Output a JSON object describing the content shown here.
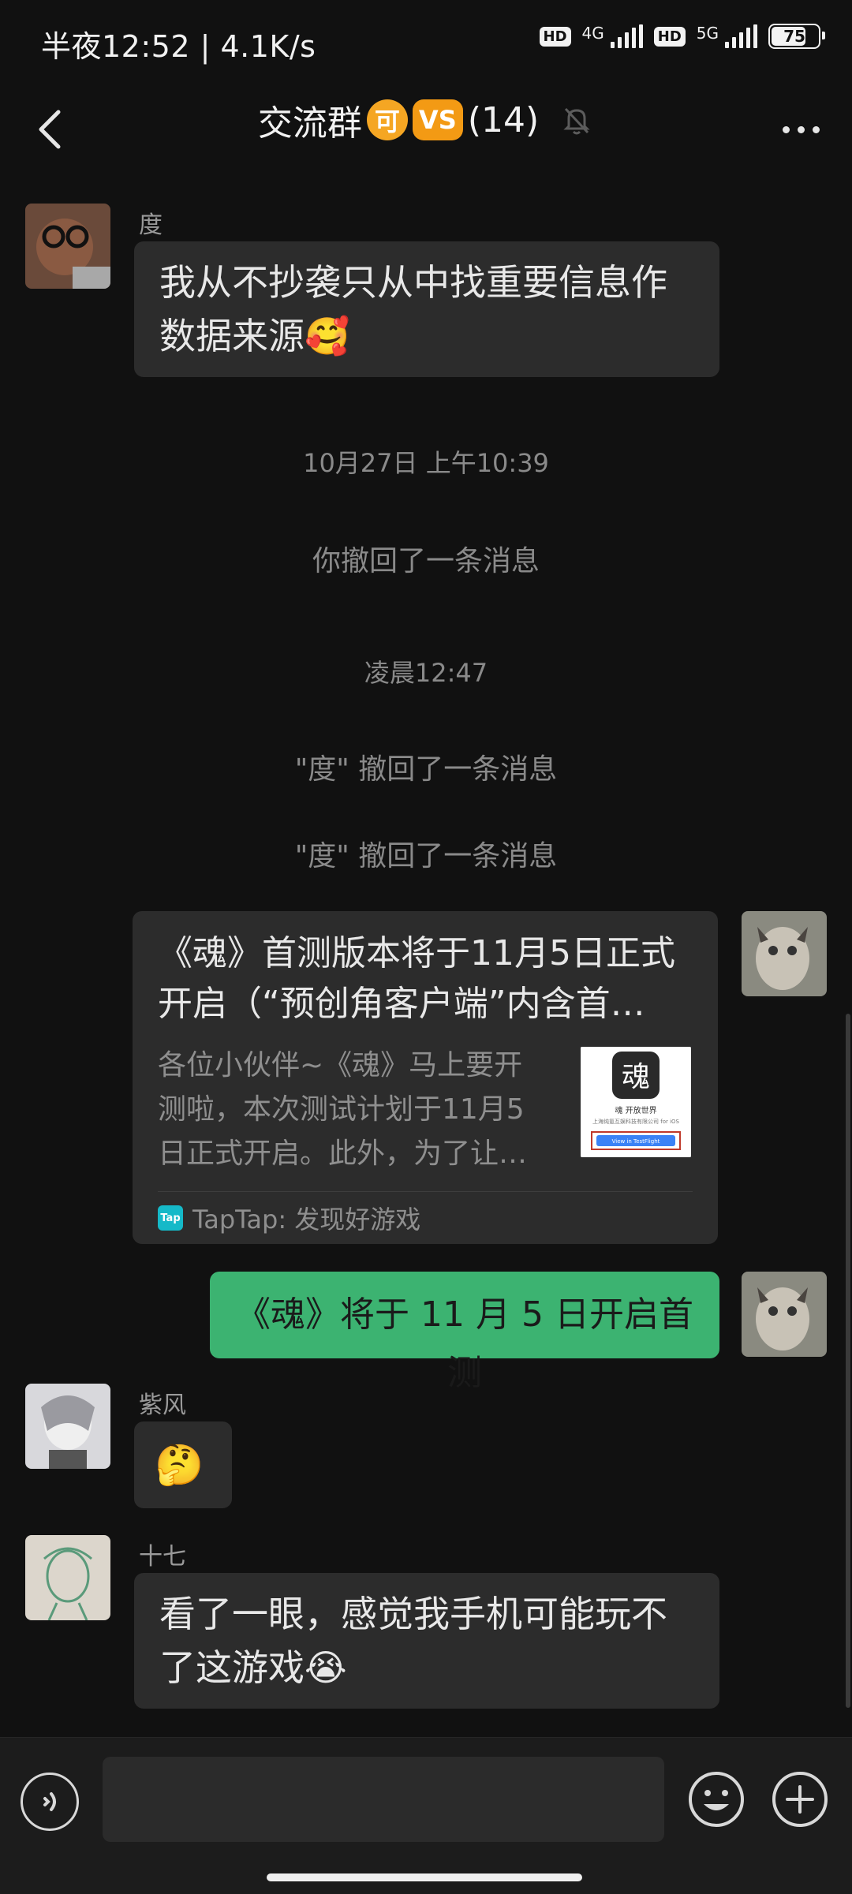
{
  "status_bar": {
    "time_speed": "半夜12:52 | 4.1K/s",
    "net1": "4G",
    "net2": "5G",
    "battery": "75",
    "hd": "HD"
  },
  "header": {
    "title": "交流群",
    "badge1": "可",
    "badge2": "VS",
    "count": "(14)"
  },
  "messages": {
    "m1": {
      "sender": "度",
      "text": "我从不抄袭只从中找重要信息作数据来源🥰"
    },
    "sys1": "10月27日 上午10:39",
    "sys2": "你撤回了一条消息",
    "sys3": "凌晨12:47",
    "sys4": "\"度\" 撤回了一条消息",
    "sys5": "\"度\" 撤回了一条消息",
    "link": {
      "title": "《魂》首测版本将于11月5日正式开启（“预创角客户端”内含首…",
      "desc": "各位小伙伴~《魂》马上要开测啦，本次测试计划于11月5日正式开启。此外，为了让…",
      "source": "TapTap: 发现好游戏",
      "tap_icon": "Tap",
      "thumb_glyph": "魂",
      "thumb_line1": "魂 开放世界",
      "thumb_line2": "上海纯氪互娱科技有限公司 for iOS",
      "thumb_button": "View in TestFlight"
    },
    "m3": {
      "text": "《魂》将于 11 月 5 日开启首测"
    },
    "m4": {
      "sender": "紫风",
      "text": "🤔"
    },
    "m5": {
      "sender": "十七",
      "text": "看了一眼，感觉我手机可能玩不了这游戏😭"
    }
  },
  "input": {
    "placeholder": ""
  }
}
